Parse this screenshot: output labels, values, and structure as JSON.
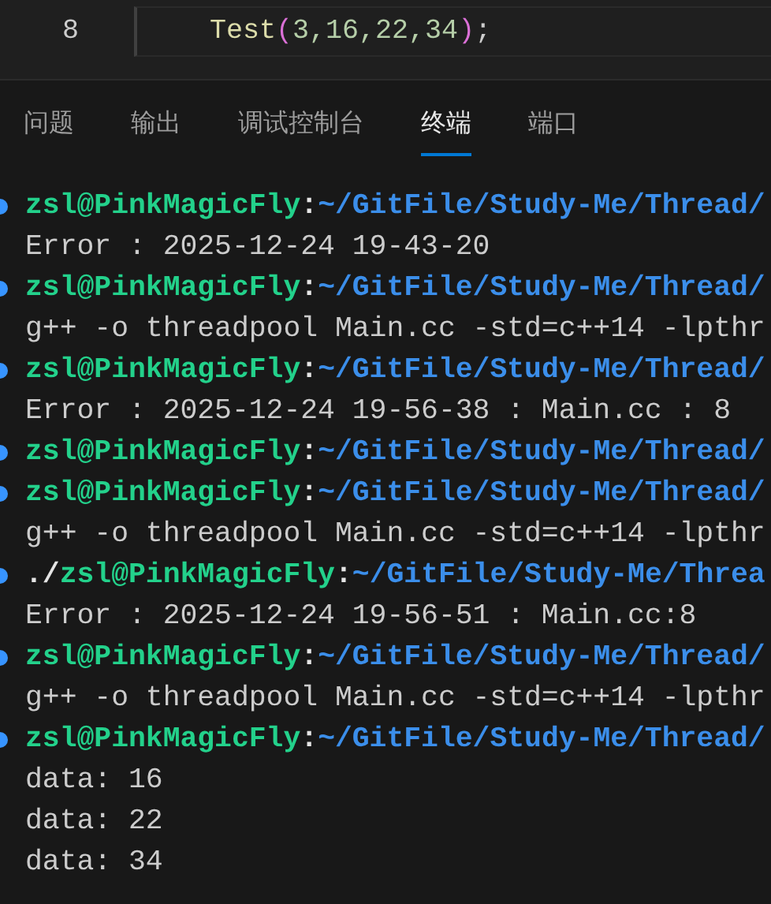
{
  "editor": {
    "lines": [
      {
        "number": "8",
        "tokens": [
          {
            "kind": "function",
            "text": "Test"
          },
          {
            "kind": "paren",
            "text": "("
          },
          {
            "kind": "number",
            "text": "3,16,22,34"
          },
          {
            "kind": "paren",
            "text": ")"
          },
          {
            "kind": "punct",
            "text": ";"
          }
        ]
      }
    ]
  },
  "panel": {
    "tabs": [
      {
        "label": "问题",
        "selected": false
      },
      {
        "label": "输出",
        "selected": false
      },
      {
        "label": "调试控制台",
        "selected": false
      },
      {
        "label": "终端",
        "selected": true
      },
      {
        "label": "端口",
        "selected": false
      }
    ]
  },
  "terminal": {
    "lines": [
      {
        "kind": "prompt",
        "user": "zsl@PinkMagicFly",
        "sep": ":",
        "path": "~/GitFile/Study-Me/Thread/"
      },
      {
        "kind": "output",
        "text": "Error : 2025-12-24 19-43-20"
      },
      {
        "kind": "prompt",
        "user": "zsl@PinkMagicFly",
        "sep": ":",
        "path": "~/GitFile/Study-Me/Thread/"
      },
      {
        "kind": "output",
        "text": "g++ -o threadpool Main.cc -std=c++14 -lpthr"
      },
      {
        "kind": "prompt",
        "user": "zsl@PinkMagicFly",
        "sep": ":",
        "path": "~/GitFile/Study-Me/Thread/"
      },
      {
        "kind": "output",
        "text": "Error : 2025-12-24 19-56-38 : Main.cc : 8"
      },
      {
        "kind": "prompt",
        "user": "zsl@PinkMagicFly",
        "sep": ":",
        "path": "~/GitFile/Study-Me/Thread/"
      },
      {
        "kind": "prompt",
        "user": "zsl@PinkMagicFly",
        "sep": ":",
        "path": "~/GitFile/Study-Me/Thread/"
      },
      {
        "kind": "output",
        "text": "g++ -o threadpool Main.cc -std=c++14 -lpthr"
      },
      {
        "kind": "prompt",
        "prefix": "./",
        "user": "zsl@PinkMagicFly",
        "sep": ":",
        "path": "~/GitFile/Study-Me/Threa"
      },
      {
        "kind": "output",
        "text": "Error : 2025-12-24 19-56-51 : Main.cc:8"
      },
      {
        "kind": "prompt",
        "user": "zsl@PinkMagicFly",
        "sep": ":",
        "path": "~/GitFile/Study-Me/Thread/"
      },
      {
        "kind": "output",
        "text": "g++ -o threadpool Main.cc -std=c++14 -lpthr"
      },
      {
        "kind": "prompt",
        "user": "zsl@PinkMagicFly",
        "sep": ":",
        "path": "~/GitFile/Study-Me/Thread/"
      },
      {
        "kind": "output",
        "text": "data: 16"
      },
      {
        "kind": "output",
        "text": "data: 22"
      },
      {
        "kind": "output",
        "text": "data: 34"
      }
    ]
  }
}
